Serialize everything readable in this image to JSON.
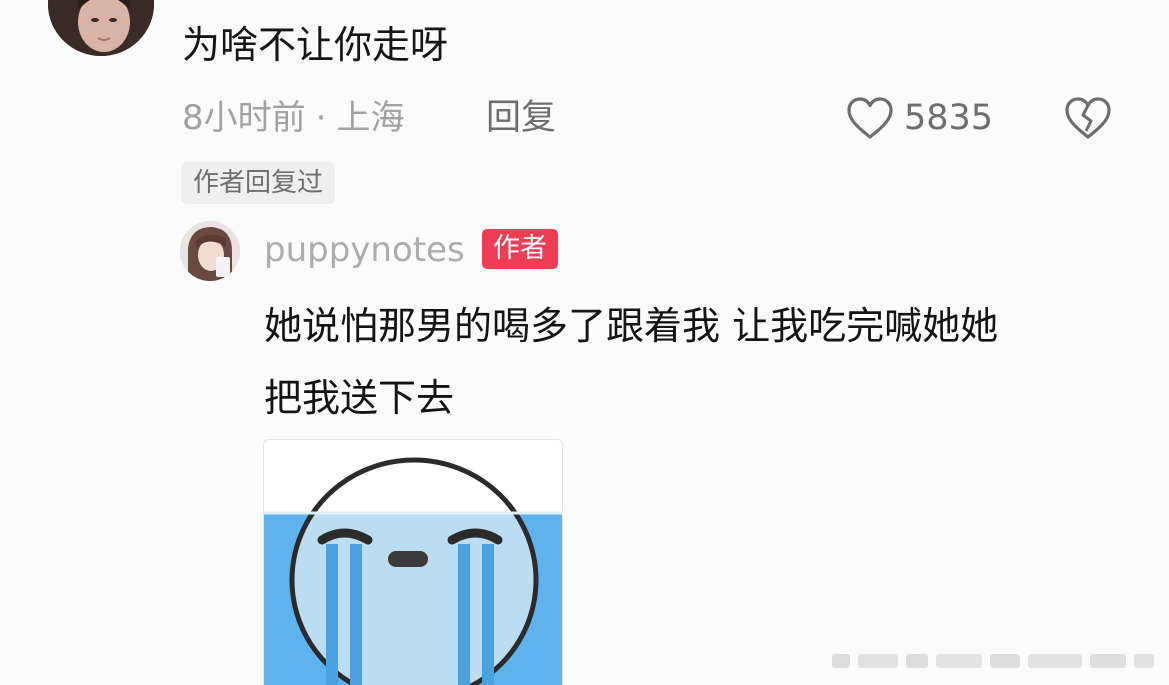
{
  "comment": {
    "text": "为啥不让你走呀",
    "time": "8小时前",
    "separator": "·",
    "location": "上海",
    "reply_label": "回复",
    "like_count": "5835",
    "author_replied_tag": "作者回复过"
  },
  "reply": {
    "username": "puppynotes",
    "badge": "作者",
    "text_line1": "她说怕那男的喝多了跟着我 让我吃完喊她她",
    "text_line2": "把我送下去"
  },
  "icons": {
    "like": "heart-icon",
    "dislike": "broken-heart-icon",
    "sticker": "crying-face-sticker"
  },
  "colors": {
    "author_badge": "#ef3d56",
    "meta_text": "#a2a2a2",
    "sticker_water": "#5fb3ec"
  }
}
